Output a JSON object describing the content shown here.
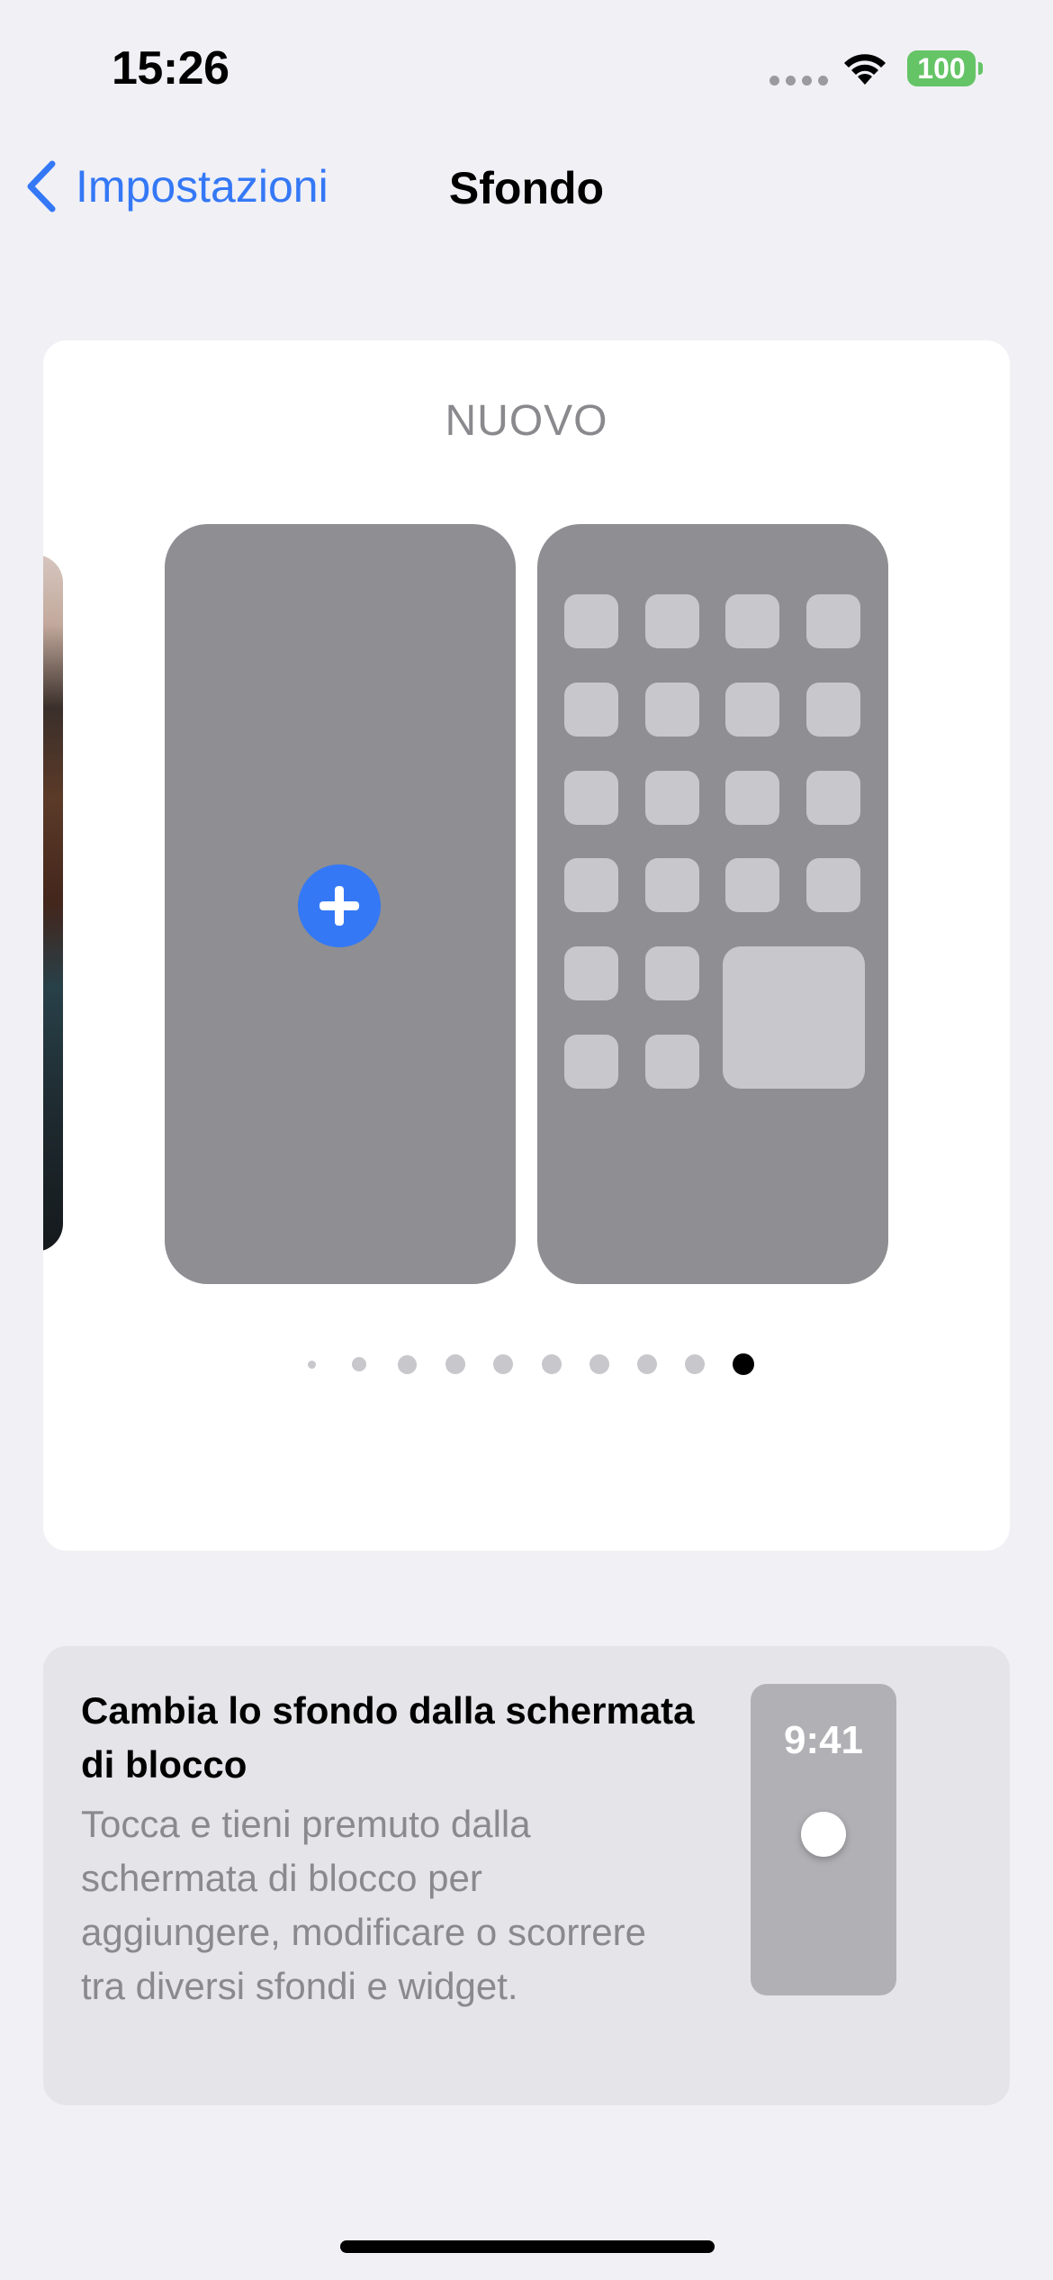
{
  "status_bar": {
    "time": "15:26",
    "battery": "100",
    "signal_icon": "cellular-dots-icon",
    "wifi_icon": "wifi-icon"
  },
  "nav": {
    "back_label": "Impostazioni",
    "title": "Sfondo",
    "back_icon": "chevron-left-icon"
  },
  "wallpaper_card": {
    "label": "NUOVO",
    "add_icon": "plus-icon",
    "page_count": 10,
    "active_page_index": 9
  },
  "info_card": {
    "title": "Cambia lo sfondo dalla schermata di blocco",
    "body": "Tocca e tieni premuto dalla schermata di blocco per aggiungere, modificare o scorrere tra diversi sfondi e widget.",
    "preview_time": "9:41"
  },
  "colors": {
    "accent": "#3478f6",
    "battery": "#65c466",
    "background": "#f0f0f5",
    "preview_gray": "#8e8e93"
  }
}
